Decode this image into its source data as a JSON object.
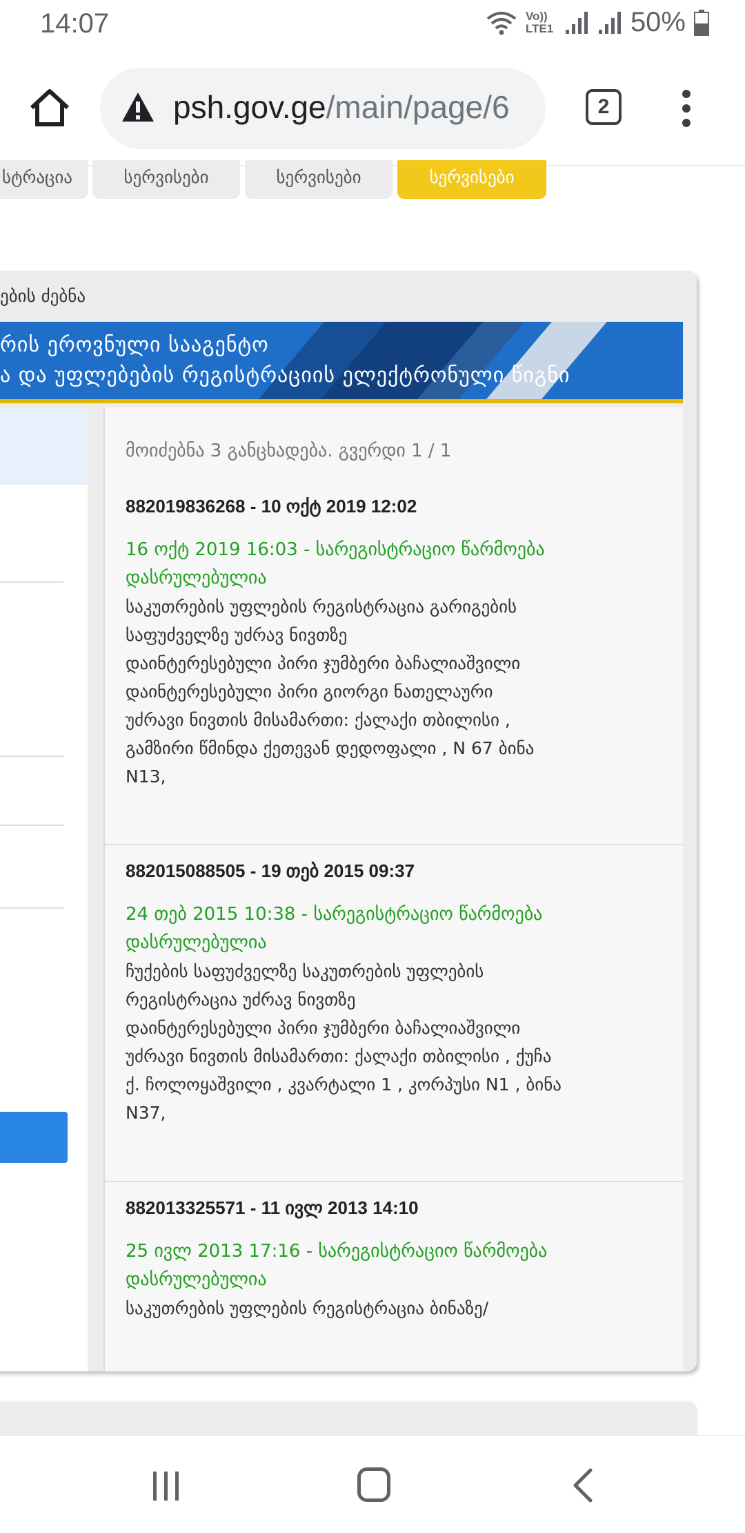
{
  "status_bar": {
    "time": "14:07",
    "network_label": "Vo)) LTE1",
    "battery": "50%",
    "icons": [
      "wifi-icon",
      "signal-icon",
      "signal-icon",
      "battery-icon"
    ]
  },
  "browser": {
    "url_host": "psh.gov.ge",
    "url_path": "/main/page/6",
    "tab_count": "2",
    "icons": [
      "home-icon",
      "not-secure-warning-icon",
      "tab-switcher-icon",
      "more-menu-icon"
    ]
  },
  "nav_tabs": [
    {
      "label": "სტრაცია",
      "active": false
    },
    {
      "label": "სერვისები",
      "active": false
    },
    {
      "label": "სერვისები",
      "active": false
    },
    {
      "label": "სერვისები",
      "active": true
    }
  ],
  "card": {
    "title": "ების ძებნა",
    "banner_line1": "რის ეროვნული სააგენტო",
    "banner_line2": "ა და უფლებების რეგისტრაციის ელექტრონული წიგნი"
  },
  "results": {
    "summary": "მოიძებნა 3 განცხადება. გვერდი 1 / 1",
    "entries": [
      {
        "head": "882019836268 - 10 ოქტ 2019 12:02",
        "status": "16 ოქტ 2019 16:03 - სარეგისტრაციო წარმოება დასრულებულია",
        "lines": [
          "საკუთრების უფლების რეგისტრაცია გარიგების",
          "საფუძველზე უძრავ ნივთზე",
          "დაინტერესებული პირი ჯუმბერი ბაჩალიაშვილი",
          "დაინტერესებული პირი გიორგი ნათელაური",
          "უძრავი ნივთის მისამართი: ქალაქი თბილისი ,",
          "გამზირი წმინდა ქეთევან დედოფალი , N 67 ბინა",
          "N13,"
        ]
      },
      {
        "head": "882015088505 - 19 თებ 2015 09:37",
        "status": "24 თებ 2015 10:38 - სარეგისტრაციო წარმოება დასრულებულია",
        "lines": [
          "ჩუქების საფუძველზე საკუთრების უფლების",
          "რეგისტრაცია უძრავ ნივთზე",
          "დაინტერესებული პირი ჯუმბერი ბაჩალიაშვილი",
          "უძრავი ნივთის მისამართი: ქალაქი თბილისი , ქუჩა",
          "ქ. ჩოლოყაშვილი , კვარტალი 1 , კორპუსი N1 , ბინა",
          "N37,"
        ]
      },
      {
        "head": "882013325571 - 11 ივლ 2013 14:10",
        "status": "25 ივლ 2013 17:16 - სარეგისტრაციო წარმოება დასრულებულია",
        "lines": [
          "საკუთრების უფლების რეგისტრაცია ბინაზე/"
        ]
      }
    ]
  },
  "android_nav": {
    "icons": [
      "recent-apps-icon",
      "home-circle-icon",
      "back-icon"
    ]
  }
}
